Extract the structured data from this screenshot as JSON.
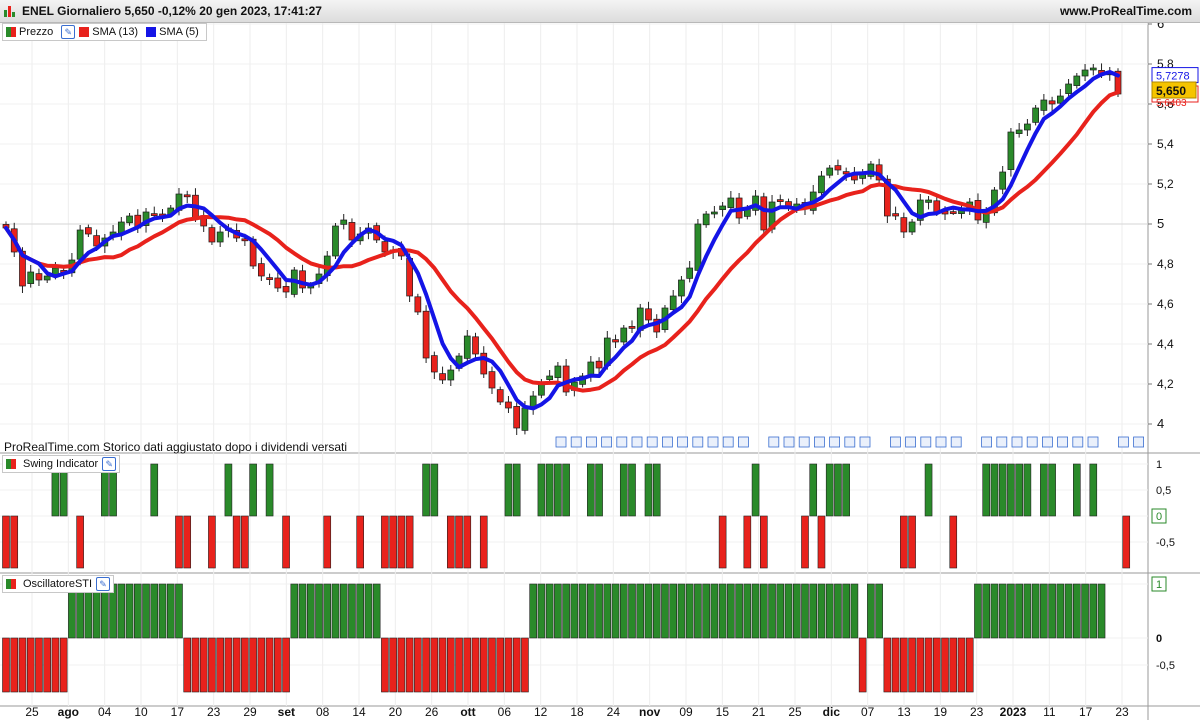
{
  "window": {
    "title": "ENEL Giornaliero 5,650 -0,12% 20 gen 2023, 17:41:27",
    "site": "www.ProRealTime.com"
  },
  "legend_price": [
    {
      "label": "Prezzo",
      "color": "#2a8a2a"
    },
    {
      "label": "SMA (13)",
      "color": "#e8221c"
    },
    {
      "label": "SMA (5)",
      "color": "#1414e6"
    }
  ],
  "legend_swing": "Swing Indicator",
  "legend_osc": "OscillatoreSTI",
  "note": "ProRealTime.com  Storico dati aggiustato dopo i dividendi versati",
  "price_labels": {
    "sma5": "5,7278",
    "last": "5,650",
    "sma13_partial": "5,6403"
  },
  "colors": {
    "up": "#2a8a2a",
    "down": "#e8221c",
    "sma5": "#1414e6",
    "sma13": "#e8221c",
    "last_label": "#f5c400"
  },
  "chart_data": [
    {
      "type": "candlestick",
      "title": "ENEL Giornaliero",
      "ylim": [
        3.9,
        6.0
      ],
      "yticks": [
        "6",
        "5,8",
        "5,6",
        "5,4",
        "5,2",
        "5",
        "4,8",
        "4,6",
        "4,4",
        "4,2",
        "4"
      ],
      "ytick_values": [
        6,
        5.8,
        5.6,
        5.4,
        5.2,
        5,
        4.8,
        4.6,
        4.4,
        4.2,
        4
      ],
      "xtick_labels": [
        "25",
        "ago",
        "04",
        "10",
        "17",
        "23",
        "29",
        "set",
        "08",
        "14",
        "20",
        "26",
        "ott",
        "06",
        "12",
        "18",
        "24",
        "nov",
        "09",
        "15",
        "21",
        "25",
        "dic",
        "07",
        "13",
        "19",
        "23",
        "2023",
        "11",
        "17",
        "23"
      ],
      "xtick_bold": [
        "ago",
        "set",
        "ott",
        "nov",
        "dic",
        "2023"
      ],
      "closes": [
        4.98,
        4.86,
        4.69,
        4.76,
        4.72,
        4.74,
        4.78,
        4.76,
        4.82,
        4.97,
        4.95,
        4.89,
        4.93,
        4.96,
        5.01,
        5.04,
        4.98,
        5.06,
        5.05,
        5.04,
        5.08,
        5.15,
        5.14,
        5.03,
        4.99,
        4.91,
        4.96,
        4.98,
        4.93,
        4.92,
        4.79,
        4.74,
        4.73,
        4.68,
        4.66,
        4.77,
        4.68,
        4.69,
        4.75,
        4.84,
        4.99,
        5.02,
        4.92,
        4.95,
        4.98,
        4.92,
        4.86,
        4.87,
        4.84,
        4.64,
        4.56,
        4.33,
        4.26,
        4.22,
        4.27,
        4.34,
        4.44,
        4.35,
        4.25,
        4.18,
        4.11,
        4.08,
        3.98,
        4.08,
        4.14,
        4.21,
        4.24,
        4.29,
        4.16,
        4.21,
        4.24,
        4.31,
        4.28,
        4.43,
        4.41,
        4.48,
        4.48,
        4.58,
        4.52,
        4.46,
        4.58,
        4.64,
        4.72,
        4.78,
        5.0,
        5.05,
        5.06,
        5.09,
        5.13,
        5.03,
        5.08,
        5.14,
        4.97,
        5.11,
        5.12,
        5.08,
        5.1,
        5.08,
        5.16,
        5.24,
        5.28,
        5.27,
        5.25,
        5.22,
        5.25,
        5.3,
        5.22,
        5.04,
        5.04,
        4.96,
        5.01,
        5.12,
        5.12,
        5.06,
        5.05,
        5.06,
        5.08,
        5.11,
        5.02,
        5.06,
        5.17,
        5.26,
        5.46,
        5.47,
        5.5,
        5.58,
        5.62,
        5.6,
        5.64,
        5.7,
        5.74,
        5.77,
        5.78,
        5.75,
        5.76,
        5.65
      ]
    },
    {
      "type": "bar",
      "title": "Swing Indicator",
      "yticks": [
        "1",
        "0,5",
        "0",
        "-0,5"
      ],
      "ylim": [
        -1.0,
        1.0
      ],
      "values": [
        -1,
        -1,
        0,
        0,
        0,
        0,
        1,
        1,
        0,
        -1,
        0,
        0,
        1,
        1,
        0,
        0,
        0,
        0,
        1,
        0,
        0,
        -1,
        -1,
        0,
        0,
        -1,
        0,
        1,
        -1,
        -1,
        1,
        0,
        1,
        0,
        -1,
        0,
        0,
        0,
        0,
        -1,
        0,
        0,
        0,
        -1,
        0,
        0,
        -1,
        -1,
        -1,
        -1,
        0,
        1,
        1,
        0,
        -1,
        -1,
        -1,
        0,
        -1,
        0,
        0,
        1,
        1,
        0,
        0,
        1,
        1,
        1,
        1,
        0,
        0,
        1,
        1,
        0,
        0,
        1,
        1,
        0,
        1,
        1,
        0,
        0,
        0,
        0,
        0,
        0,
        0,
        -1,
        0,
        0,
        -1,
        1,
        -1,
        0,
        0,
        0,
        0,
        -1,
        1,
        -1,
        1,
        1,
        1,
        0,
        0,
        0,
        0,
        0,
        0,
        -1,
        -1,
        0,
        1,
        0,
        0,
        -1,
        0,
        0,
        0,
        1,
        1,
        1,
        1,
        1,
        1,
        0,
        1,
        1,
        0,
        0,
        1,
        0,
        1,
        0,
        0,
        0,
        -1
      ]
    },
    {
      "type": "bar",
      "title": "OscillatoreSTI",
      "yticks": [
        "1",
        "0",
        "-0,5"
      ],
      "ylim": [
        -1.0,
        1.0
      ],
      "values": [
        -1,
        -1,
        -1,
        -1,
        -1,
        -1,
        -1,
        -1,
        1,
        1,
        1,
        1,
        1,
        1,
        1,
        1,
        1,
        1,
        1,
        1,
        1,
        1,
        -1,
        -1,
        -1,
        -1,
        -1,
        -1,
        -1,
        -1,
        -1,
        -1,
        -1,
        -1,
        -1,
        1,
        1,
        1,
        1,
        1,
        1,
        1,
        1,
        1,
        1,
        1,
        -1,
        -1,
        -1,
        -1,
        -1,
        -1,
        -1,
        -1,
        -1,
        -1,
        -1,
        -1,
        -1,
        -1,
        -1,
        -1,
        -1,
        -1,
        1,
        1,
        1,
        1,
        1,
        1,
        1,
        1,
        1,
        1,
        1,
        1,
        1,
        1,
        1,
        1,
        1,
        1,
        1,
        1,
        1,
        1,
        1,
        1,
        1,
        1,
        1,
        1,
        1,
        1,
        1,
        1,
        1,
        1,
        1,
        1,
        1,
        1,
        1,
        1,
        -1,
        1,
        1,
        -1,
        -1,
        -1,
        -1,
        -1,
        -1,
        -1,
        -1,
        -1,
        -1,
        -1,
        1,
        1,
        1,
        1,
        1,
        1,
        1,
        1,
        1,
        1,
        1,
        1,
        1,
        1,
        1,
        1
      ]
    }
  ]
}
